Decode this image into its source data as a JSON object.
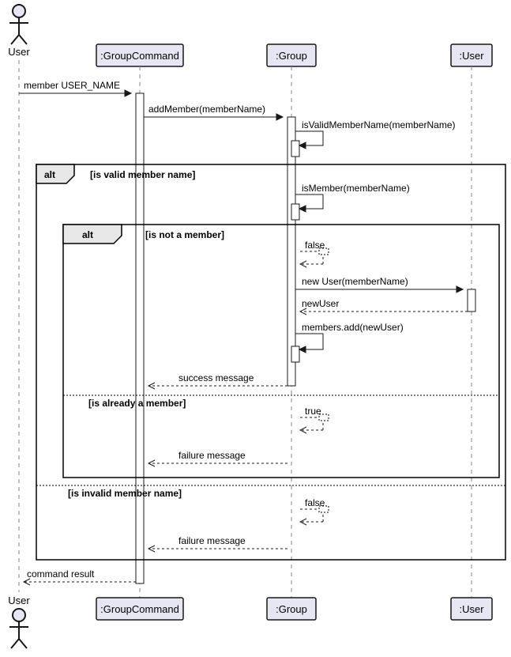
{
  "actor": {
    "name": "User"
  },
  "participants": {
    "groupCommand": ":GroupCommand",
    "group": ":Group",
    "user": ":User"
  },
  "messages": {
    "m1": "member USER_NAME",
    "m2": "addMember(memberName)",
    "m3": "isValidMemberName(memberName)",
    "m4": "isMember(memberName)",
    "m5_false": "false",
    "m6": "new User(memberName)",
    "m7": "newUser",
    "m8": "members.add(newUser)",
    "m9": "success message",
    "m10_true": "true",
    "m11": "failure message",
    "m12_false": "false",
    "m13": "failure message",
    "m14": "command result"
  },
  "frames": {
    "alt1": "alt",
    "alt1_guard1": "[is valid member name]",
    "alt1_guard2": "[is invalid member name]",
    "alt2": "alt",
    "alt2_guard1": "[is not a member]",
    "alt2_guard2": "[is already a member]"
  }
}
